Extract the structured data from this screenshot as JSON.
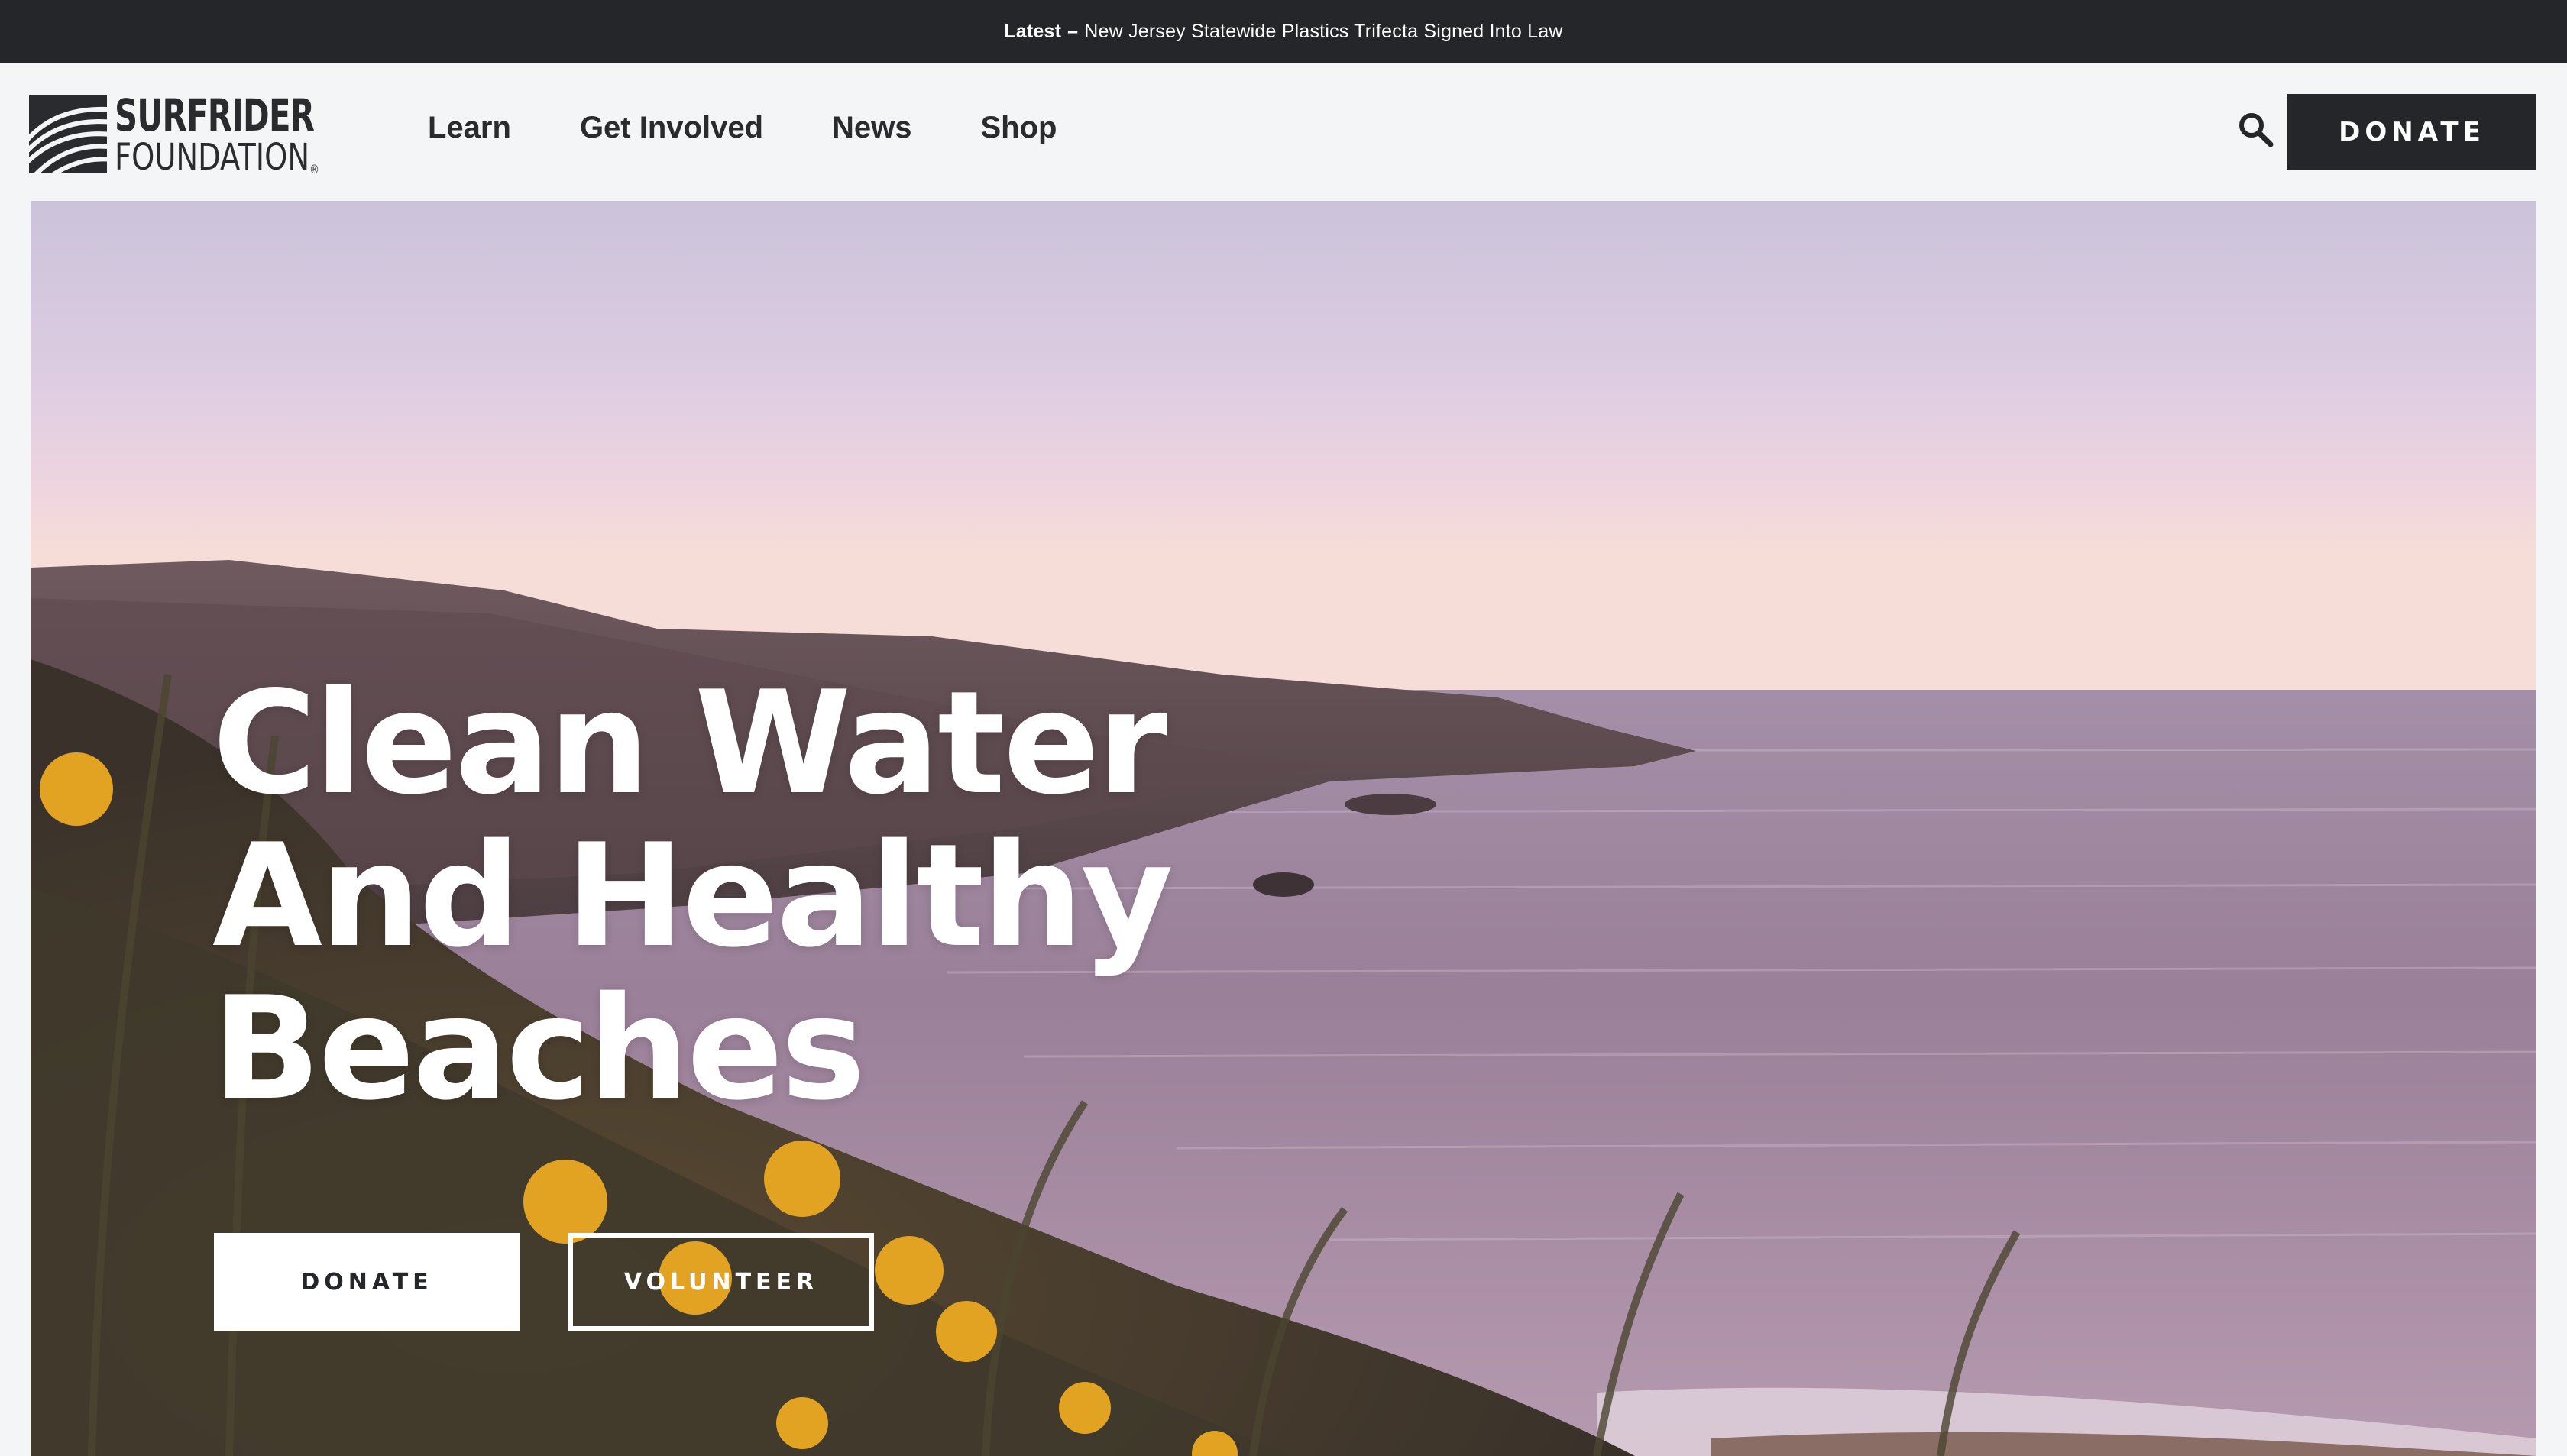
{
  "announcement": {
    "label": "Latest",
    "separator": "–",
    "text": "New Jersey Statewide Plastics Trifecta Signed Into Law"
  },
  "logo": {
    "line1": "SURFRIDER",
    "line2": "FOUNDATION",
    "registered": "®"
  },
  "nav": {
    "items": [
      {
        "label": "Learn"
      },
      {
        "label": "Get Involved"
      },
      {
        "label": "News"
      },
      {
        "label": "Shop"
      }
    ]
  },
  "header": {
    "search_icon": "search-icon",
    "donate_label": "DONATE"
  },
  "hero": {
    "title_lines": [
      "Clean Water",
      "And Healthy",
      "Beaches"
    ],
    "donate_label": "DONATE",
    "volunteer_label": "VOLUNTEER"
  },
  "colors": {
    "dark": "#24262a",
    "page_bg": "#f4f5f7",
    "white": "#ffffff"
  }
}
